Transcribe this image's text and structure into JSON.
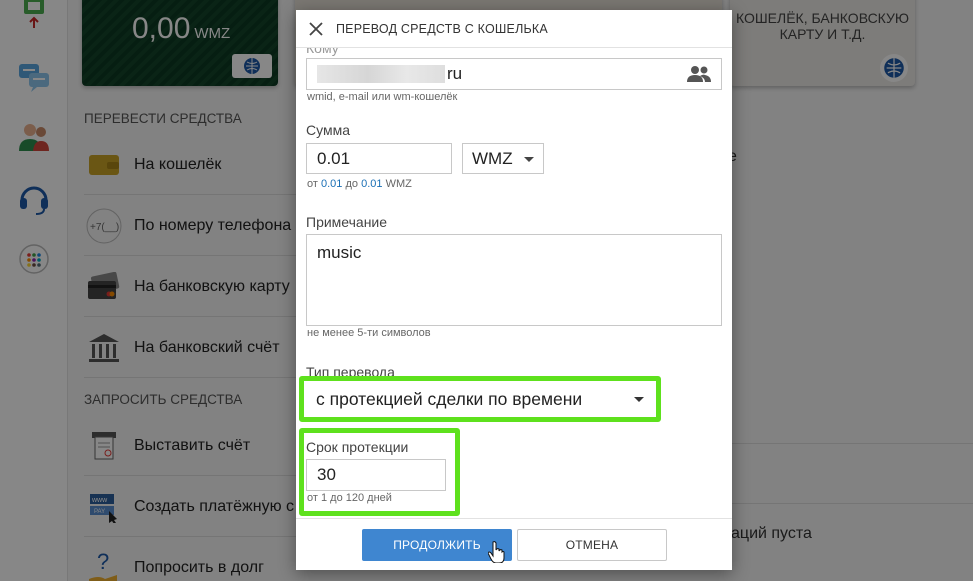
{
  "background": {
    "balance": {
      "amount": "0,00",
      "currency": "WMZ"
    },
    "right_card_text": "КОШЕЛЁК, БАНКОВСКУЮ КАРТУ И Т.Д.",
    "section_transfer": "ПЕРЕВЕСТИ СРЕДСТВА",
    "transfer_items": [
      {
        "label": "На кошелёк",
        "icon": "wallet-icon"
      },
      {
        "label": "По номеру телефона",
        "icon": "phone-number-icon"
      },
      {
        "label": "На банковскую карту",
        "icon": "bank-card-icon"
      },
      {
        "label": "На банковский счёт",
        "icon": "bank-icon"
      }
    ],
    "section_request": "ЗАПРОСИТЬ СРЕДСТВА",
    "request_items": [
      {
        "label": "Выставить счёт",
        "icon": "invoice-icon"
      },
      {
        "label": "Создать платёжную с",
        "icon": "payment-link-icon"
      },
      {
        "label": "Попросить в долг",
        "icon": "loan-request-icon"
      }
    ],
    "right_fragment_1": "е",
    "right_fragment_2": "аций пуста"
  },
  "modal": {
    "title": "ПЕРЕВОД СРЕДСТВ С КОШЕЛЬКА",
    "recipient": {
      "label": "Кому",
      "value_suffix": "ru",
      "hint": "wmid, e-mail или wm-кошелёк"
    },
    "amount": {
      "label": "Сумма",
      "value": "0.01",
      "currency": "WMZ",
      "hint_from": "от",
      "hint_min": "0.01",
      "hint_to": "до",
      "hint_max": "0.01",
      "hint_currency": "WMZ"
    },
    "note": {
      "label": "Примечание",
      "value": "music",
      "hint": "не менее 5-ти символов"
    },
    "transfer_type": {
      "label": "Тип перевода",
      "value": "с протекцией сделки по времени"
    },
    "protection": {
      "label": "Срок протекции",
      "value": "30",
      "hint": "от 1 до 120 дней"
    },
    "continue_label": "ПРОДОЛЖИТЬ",
    "cancel_label": "ОТМЕНА"
  },
  "colors": {
    "highlight": "#5ee11d",
    "primary_button": "#3f86d0",
    "link_number": "#1a6fb5"
  }
}
